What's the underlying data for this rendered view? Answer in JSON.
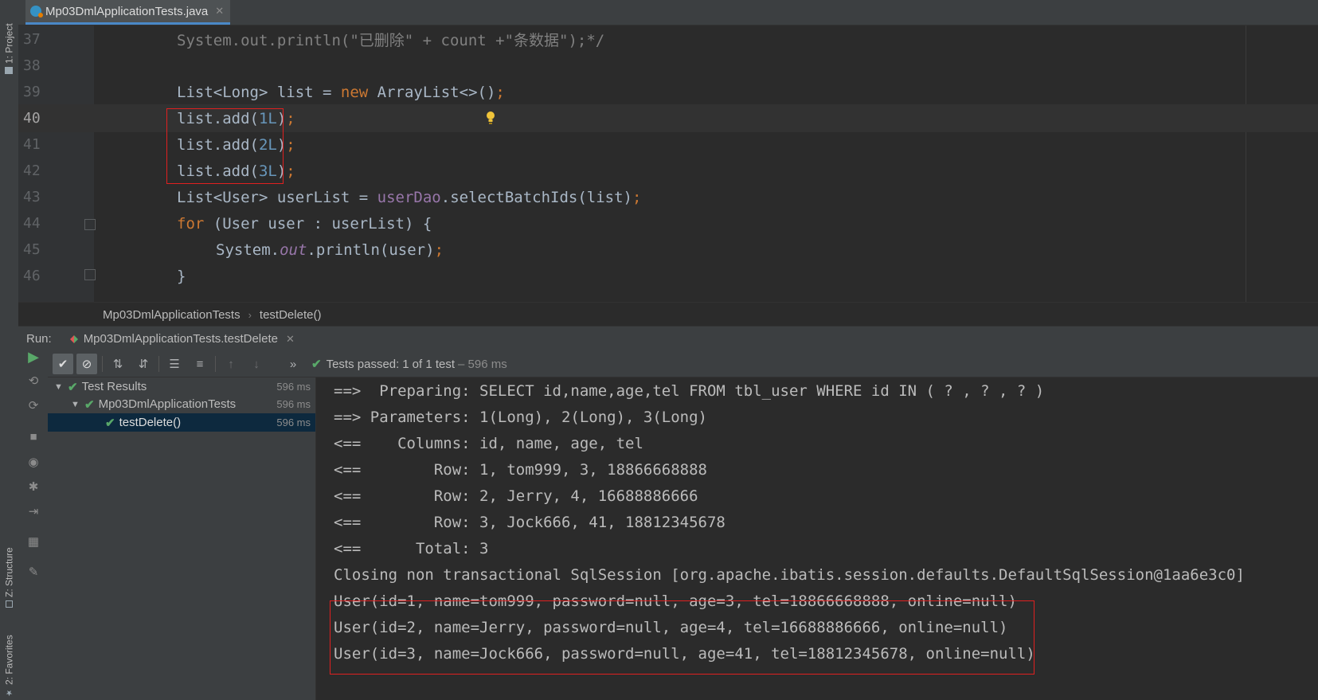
{
  "side_tabs": {
    "project": "1: Project",
    "structure": "Z: Structure",
    "favorites": "2: Favorites"
  },
  "editor_tab": {
    "filename": "Mp03DmlApplicationTests.java",
    "icon": "java-class-icon"
  },
  "code_lines": [
    {
      "num": "37",
      "text": "System.out.println(\"已删除\" + count +\"条数据\");*/"
    },
    {
      "num": "38",
      "text": ""
    },
    {
      "num": "39",
      "text": "List<Long> list = new ArrayList<>();"
    },
    {
      "num": "40",
      "text": "list.add(1L);"
    },
    {
      "num": "41",
      "text": "list.add(2L);"
    },
    {
      "num": "42",
      "text": "list.add(3L);"
    },
    {
      "num": "43",
      "text": "List<User> userList = userDao.selectBatchIds(list);"
    },
    {
      "num": "44",
      "text": "for (User user : userList) {"
    },
    {
      "num": "45",
      "text": "System.out.println(user);"
    },
    {
      "num": "46",
      "text": "}"
    }
  ],
  "breadcrumb": {
    "class_name": "Mp03DmlApplicationTests",
    "method_name": "testDelete()"
  },
  "run_panel": {
    "label": "Run:",
    "config_tab": "Mp03DmlApplicationTests.testDelete",
    "status": {
      "prefix": "Tests passed:",
      "passed": "1",
      "middle": "of 1 test",
      "duration": "– 596 ms"
    },
    "tree": [
      {
        "label": "Test Results",
        "time": "596 ms"
      },
      {
        "label": "Mp03DmlApplicationTests",
        "time": "596 ms"
      },
      {
        "label": "testDelete()",
        "time": "596 ms"
      }
    ],
    "console": [
      "==>  Preparing: SELECT id,name,age,tel FROM tbl_user WHERE id IN ( ? , ? , ? )",
      "==> Parameters: 1(Long), 2(Long), 3(Long)",
      "<==    Columns: id, name, age, tel",
      "<==        Row: 1, tom999, 3, 18866668888",
      "<==        Row: 2, Jerry, 4, 16688886666",
      "<==        Row: 3, Jock666, 41, 18812345678",
      "<==      Total: 3",
      "Closing non transactional SqlSession [org.apache.ibatis.session.defaults.DefaultSqlSession@1aa6e3c0]",
      "User(id=1, name=tom999, password=null, age=3, tel=18866668888, online=null)",
      "User(id=2, name=Jerry, password=null, age=4, tel=16688886666, online=null)",
      "User(id=3, name=Jock666, password=null, age=41, tel=18812345678, online=null)"
    ]
  },
  "colors": {
    "background": "#2b2b2b",
    "keyword": "#cc7832",
    "number": "#6897bb",
    "field": "#9876aa",
    "pass_green": "#59a869",
    "highlight_box": "#e02020"
  }
}
